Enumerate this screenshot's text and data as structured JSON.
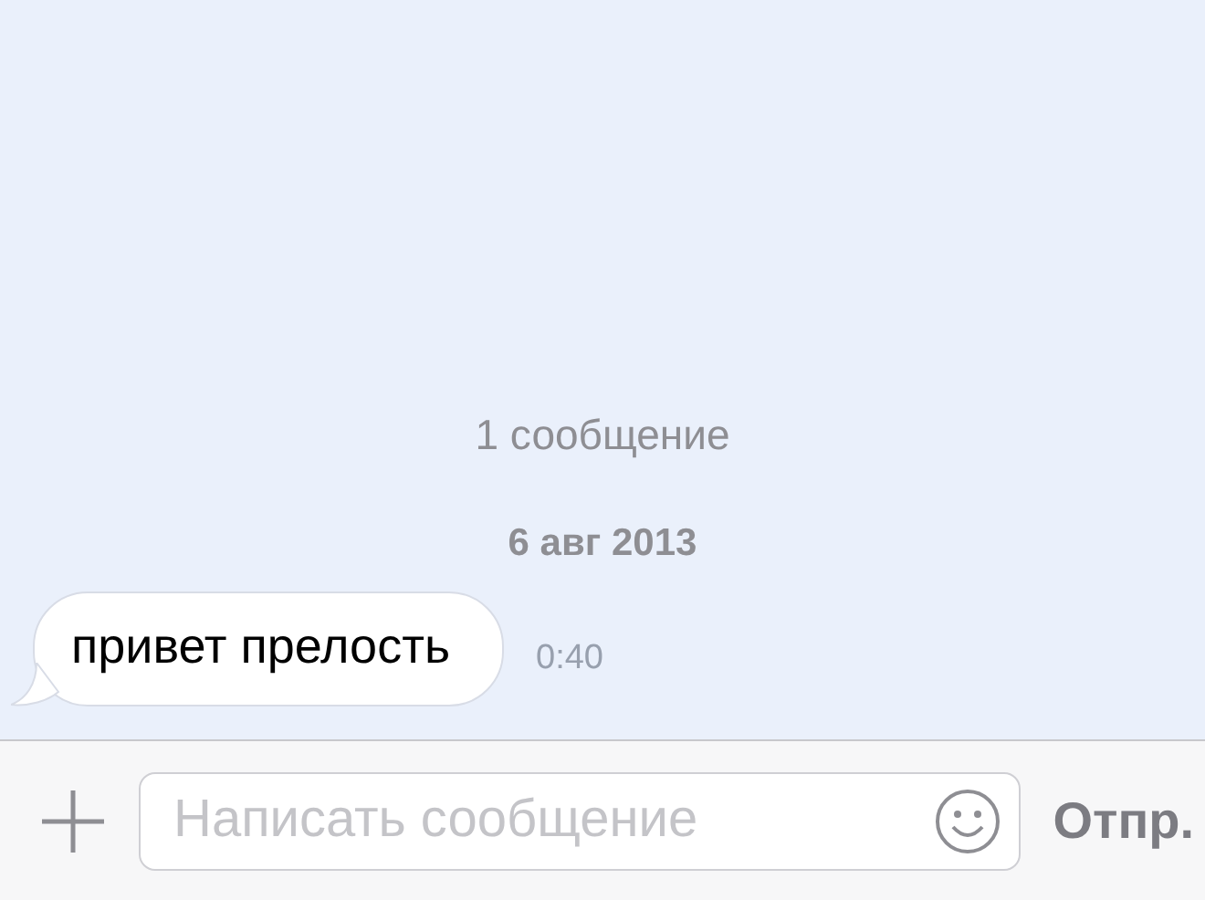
{
  "chat": {
    "message_count": "1 сообщение",
    "date": "6 авг 2013",
    "messages": [
      {
        "text": "привет прелость",
        "time": "0:40",
        "kind": "incoming"
      }
    ]
  },
  "composer": {
    "placeholder": "Написать сообщение",
    "send_label": "Отпр."
  }
}
